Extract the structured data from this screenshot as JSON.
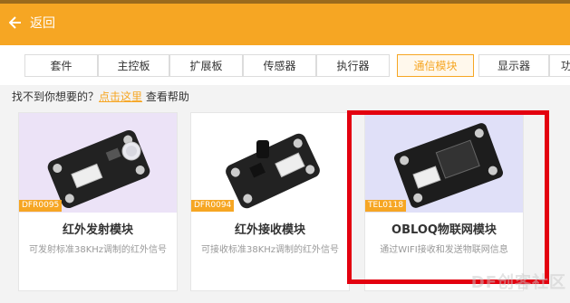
{
  "header": {
    "back_label": "返回",
    "bg_color": "#f6a623"
  },
  "tabs": [
    {
      "label": "套件"
    },
    {
      "label": "主控板"
    },
    {
      "label": "扩展板"
    },
    {
      "label": "传感器"
    },
    {
      "label": "执行器"
    },
    {
      "label": "通信模块",
      "active": true
    },
    {
      "label": "显示器"
    },
    {
      "label": "功"
    }
  ],
  "help": {
    "prefix": "找不到你想要的？",
    "link": "点击这里",
    "suffix": "查看帮助"
  },
  "cards": [
    {
      "code": "DFR0095",
      "title": "红外发射模块",
      "desc": "可发射标准38KHz调制的红外信号"
    },
    {
      "code": "DFR0094",
      "title": "红外接收模块",
      "desc": "可接收标准38KHz调制的红外信号"
    },
    {
      "code": "TEL0118",
      "title": "OBLOQ物联网模块",
      "desc": "通过WIFI接收和发送物联网信息"
    }
  ],
  "watermark": "DF创客社区",
  "colors": {
    "accent": "#f6a623",
    "highlight": "#e3000f"
  }
}
